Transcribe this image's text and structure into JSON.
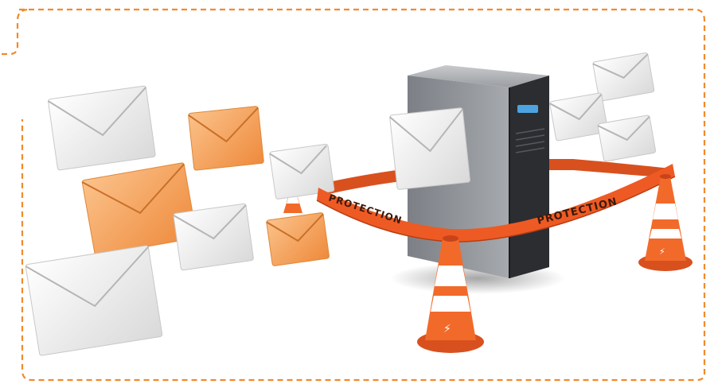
{
  "illustration": {
    "tape_labels": [
      "PROTECTION",
      "PROTECTION"
    ],
    "colors": {
      "frame_dash": "#f08a2e",
      "tape": "#ee5a24",
      "tape_dark": "#c9431a",
      "cone": "#f26a2a",
      "cone_stripe": "#ffffff",
      "server_body": "#8f9398",
      "server_front": "#2b2d31",
      "server_led": "#4da3e0",
      "envelope_white": "#f4f4f4",
      "envelope_orange": "#f6a35a"
    }
  }
}
